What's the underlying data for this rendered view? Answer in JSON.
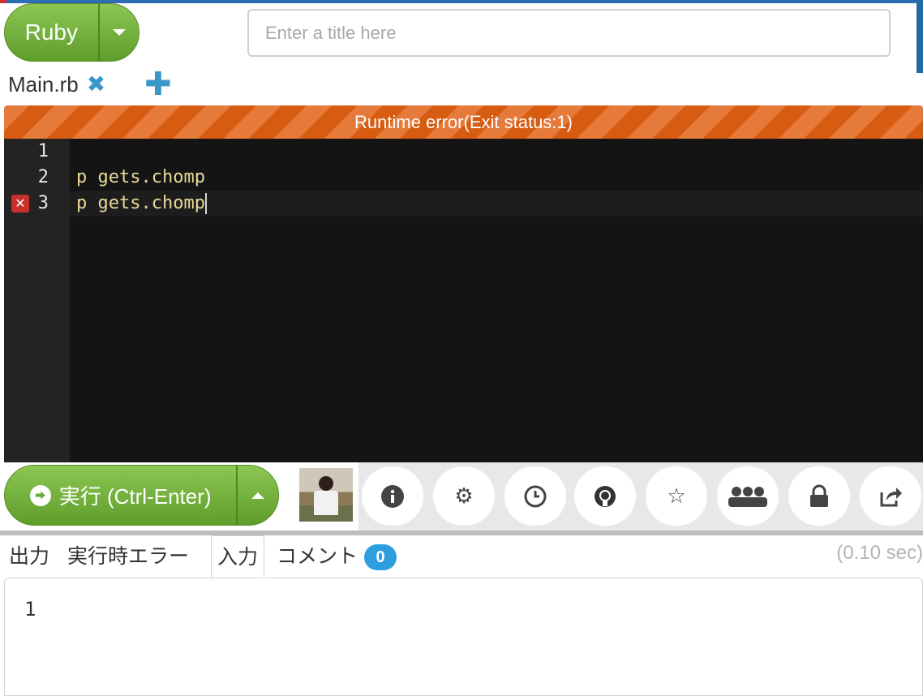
{
  "header": {
    "language_label": "Ruby",
    "title_placeholder": "Enter a title here"
  },
  "files": {
    "tab_name": "Main.rb"
  },
  "status": {
    "message": "Runtime error(Exit status:1)"
  },
  "editor": {
    "line_numbers": [
      "1",
      "2",
      "3"
    ],
    "lines": [
      "",
      "p gets.chomp",
      "p gets.chomp"
    ],
    "error_line": 3
  },
  "toolbar": {
    "run_label": "実行 (Ctrl-Enter)",
    "icons": [
      "info-icon",
      "gear-icon",
      "clock-icon",
      "github-icon",
      "star-icon",
      "users-icon",
      "lock-icon",
      "share-icon"
    ]
  },
  "output_tabs": {
    "output": "出力",
    "runtime_error": "実行時エラー",
    "input": "入力",
    "comment": "コメント",
    "comment_count": "0",
    "elapsed": "(0.10 sec)"
  },
  "output": {
    "text": "1"
  },
  "colors": {
    "accent_green": "#6aa935",
    "error_orange": "#d75b10",
    "badge_blue": "#2d9ee0",
    "editor_bg": "#141414"
  }
}
